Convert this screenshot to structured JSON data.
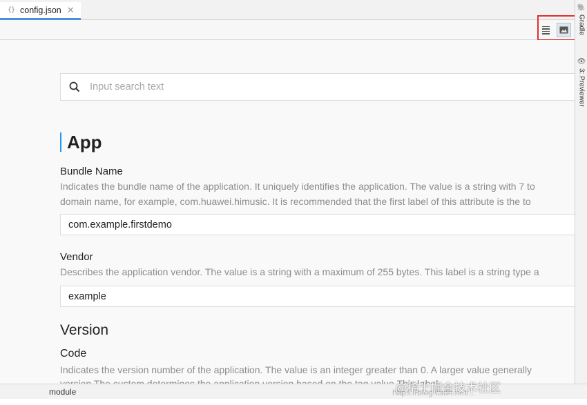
{
  "tab": {
    "label": "config.json",
    "icon": "json-file-icon"
  },
  "toolbar": {
    "buttons": [
      "list-view-icon",
      "image-preview-icon"
    ],
    "highlight_color": "#e03030"
  },
  "side_tabs": [
    {
      "label": "Gradle",
      "icon": "gradle-icon"
    },
    {
      "label": "3: Previewer",
      "icon": "eye-icon"
    }
  ],
  "search": {
    "placeholder": "Input search text",
    "value": ""
  },
  "app": {
    "title": "App",
    "accent": "#2196f3",
    "bundle_name": {
      "label": "Bundle Name",
      "desc_line1": "Indicates the bundle name of the application. It uniquely identifies the application. The value is a string with 7 to",
      "desc_line2": "domain name, for example, com.huawei.himusic. It is recommended that the first label of this attribute is the to",
      "value": "com.example.firstdemo"
    },
    "vendor": {
      "label": "Vendor",
      "desc": "Describes the application vendor. The value is a string with a maximum of 255 bytes. This label is a string type a",
      "value": "example"
    },
    "version": {
      "title": "Version",
      "code": {
        "label": "Code",
        "desc_line1": "Indicates the version number of the application. The value is an integer greater than 0. A larger value generally",
        "desc_line2": "version The custom determines the application version based on the tag value This label"
      }
    }
  },
  "statusbar": {
    "module": "module"
  },
  "watermark": {
    "text": "@稀土掘金技术社区",
    "url": "https://blog.csdn.net/..."
  }
}
